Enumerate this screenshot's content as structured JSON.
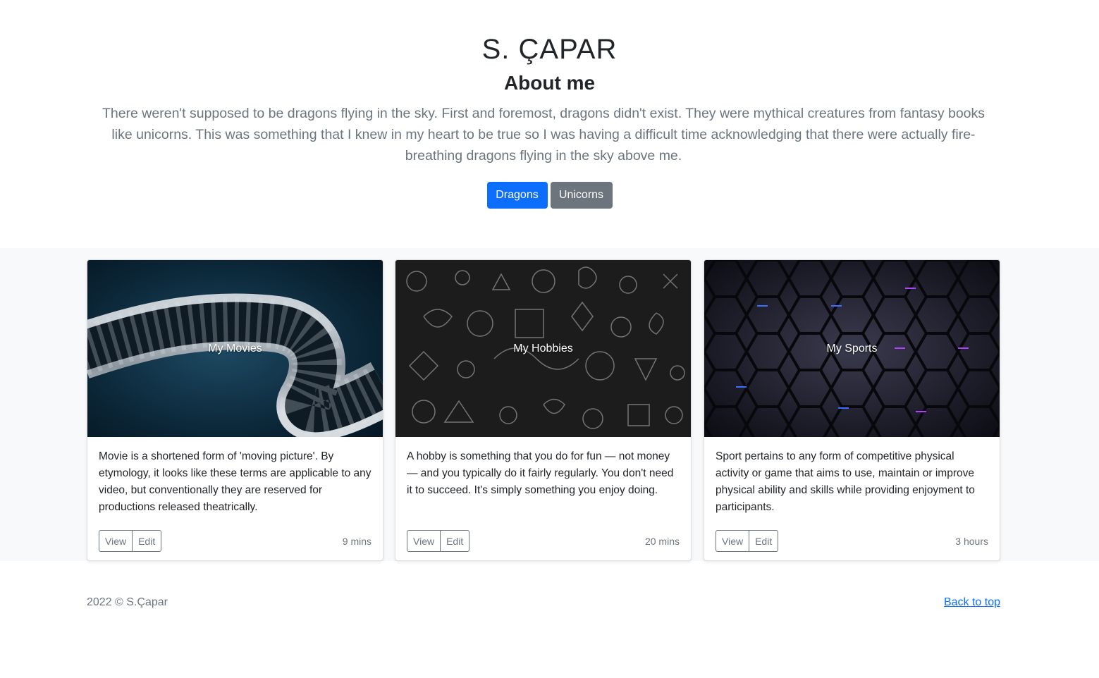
{
  "hero": {
    "name": "S. ÇAPAR",
    "heading": "About me",
    "lead": "There weren't supposed to be dragons flying in the sky. First and foremost, dragons didn't exist. They were mythical creatures from fantasy books like unicorns. This was something that I knew in my heart to be true so I was having a difficult time acknowledging that there were actually fire-breathing dragons flying in the sky above me.",
    "primary_button": "Dragons",
    "secondary_button": "Unicorns"
  },
  "cards": [
    {
      "title": "My Movies",
      "text": "Movie is a shortened form of 'moving picture'. By etymology, it looks like these terms are applicable to any video, but conventionally they are reserved for productions released theatrically.",
      "view": "View",
      "edit": "Edit",
      "time": "9 mins"
    },
    {
      "title": "My Hobbies",
      "text": "A hobby is something that you do for fun — not money — and you typically do it fairly regularly. You don't need it to succeed. It's simply something you enjoy doing.",
      "view": "View",
      "edit": "Edit",
      "time": "20 mins"
    },
    {
      "title": "My Sports",
      "text": "Sport pertains to any form of competitive physical activity or game that aims to use, maintain or improve physical ability and skills while providing enjoyment to participants.",
      "view": "View",
      "edit": "Edit",
      "time": "3 hours"
    }
  ],
  "footer": {
    "copyright": "2022 © S.Çapar",
    "back_to_top": "Back to top"
  },
  "colors": {
    "primary": "#0d6efd",
    "secondary": "#6c757d",
    "album_bg": "#f8f9fa"
  }
}
